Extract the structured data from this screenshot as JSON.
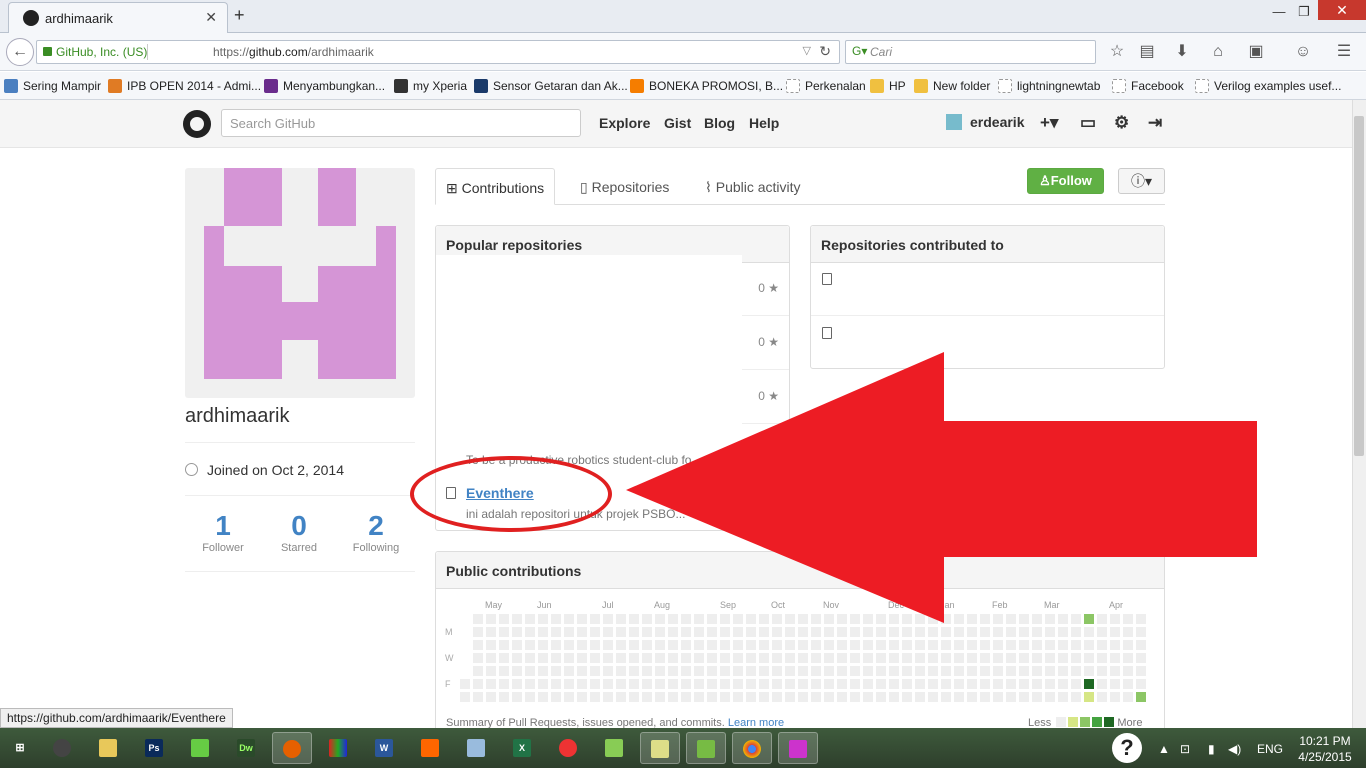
{
  "browser": {
    "tab_title": "ardhimaarik",
    "identity": "GitHub, Inc. (US)",
    "url_prefix": "https://",
    "url_domain": "github.com",
    "url_path": "/ardhimaarik",
    "search_placeholder": "Cari",
    "bookmarks": [
      {
        "label": "Sering Mampir",
        "color": "#4a7fc0"
      },
      {
        "label": "IPB OPEN 2014 - Admi...",
        "color": "#e07b24"
      },
      {
        "label": "Menyambungkan...",
        "color": "#6a2c8c"
      },
      {
        "label": "my Xperia",
        "color": "#333333"
      },
      {
        "label": "Sensor Getaran dan Ak...",
        "color": "#1a3a6a"
      },
      {
        "label": "BONEKA PROMOSI, B...",
        "color": "#f57d00"
      },
      {
        "label": "Perkenalan",
        "color": "#ffffff"
      },
      {
        "label": "HP",
        "color": "#f0c040"
      },
      {
        "label": "New folder",
        "color": "#f0c040"
      },
      {
        "label": "lightningnewtab",
        "color": "#ffffff"
      },
      {
        "label": "Facebook",
        "color": "#ffffff"
      },
      {
        "label": "Verilog examples usef...",
        "color": "#ffffff"
      }
    ],
    "status_url": "https://github.com/ardhimaarik/Eventhere"
  },
  "github": {
    "search_placeholder": "Search GitHub",
    "nav": [
      "Explore",
      "Gist",
      "Blog",
      "Help"
    ],
    "username": "erdearik"
  },
  "profile": {
    "name": "ardhimaarik",
    "joined": "Joined on Oct 2, 2014",
    "stats": [
      {
        "value": "1",
        "label": "Follower"
      },
      {
        "value": "0",
        "label": "Starred"
      },
      {
        "value": "2",
        "label": "Following"
      }
    ],
    "avatar_color": "#d595d6"
  },
  "tabs": {
    "contributions": "Contributions",
    "repositories": "Repositories",
    "public_activity": "Public activity",
    "follow": "Follow"
  },
  "popular": {
    "title": "Popular repositories",
    "star_counts": [
      "0",
      "0",
      "0"
    ],
    "robotics_desc": "To be a productive robotics student-club fo...",
    "repo_name": "Eventhere",
    "repo_desc": "ini adalah repositori untuk projek PSBO..."
  },
  "contributed": {
    "title": "Repositories contributed to"
  },
  "public_contributions": {
    "title": "Public contributions",
    "months": [
      "May",
      "Jun",
      "Jul",
      "Aug",
      "Sep",
      "Oct",
      "Nov",
      "Dec",
      "Jan",
      "Feb",
      "Mar",
      "Apr"
    ],
    "weekdays": [
      "M",
      "W",
      "F"
    ],
    "summary": "Summary of Pull Requests, issues opened, and commits.",
    "learn_more": "Learn more",
    "less": "Less",
    "more": "More",
    "legend_colors": [
      "#eeeeee",
      "#d6e685",
      "#8cc665",
      "#44a340",
      "#1e6823"
    ]
  },
  "taskbar": {
    "lang": "ENG",
    "time": "10:21 PM",
    "date": "4/25/2015"
  }
}
